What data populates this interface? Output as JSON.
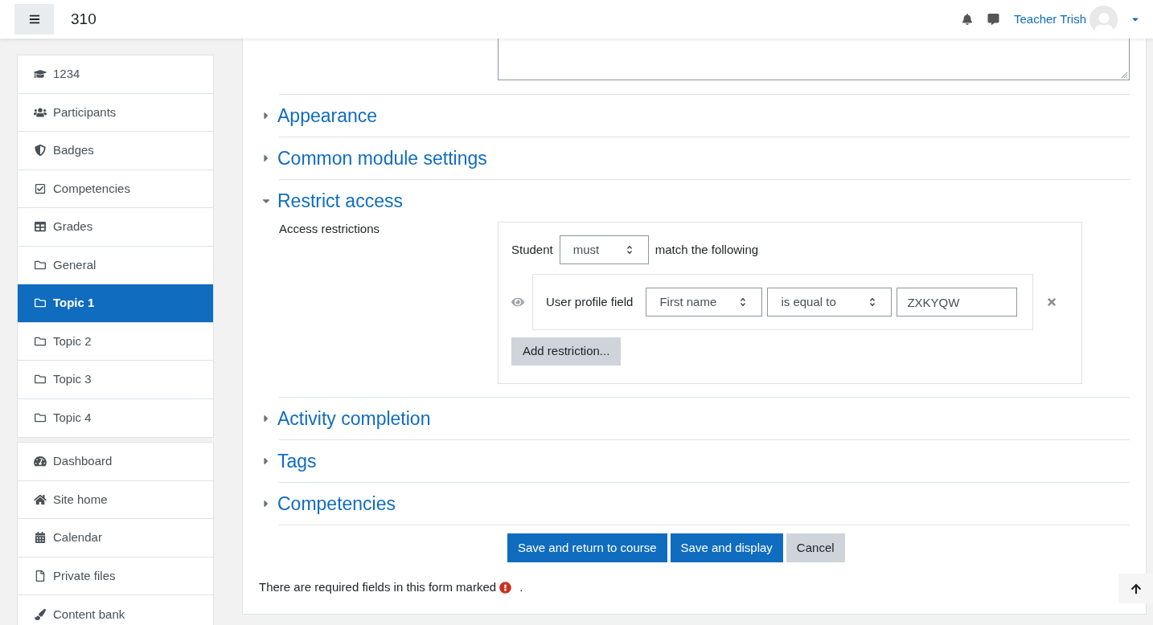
{
  "header": {
    "course": "310",
    "user": "Teacher Trish"
  },
  "nav_groups": [
    [
      {
        "label": "1234",
        "selected": false
      },
      {
        "label": "Participants",
        "selected": false
      },
      {
        "label": "Badges",
        "selected": false
      },
      {
        "label": "Competencies",
        "selected": false
      },
      {
        "label": "Grades",
        "selected": false
      },
      {
        "label": "General",
        "selected": false
      },
      {
        "label": "Topic 1",
        "selected": true
      },
      {
        "label": "Topic 2",
        "selected": false
      },
      {
        "label": "Topic 3",
        "selected": false
      },
      {
        "label": "Topic 4",
        "selected": false
      }
    ],
    [
      {
        "label": "Dashboard",
        "selected": false
      },
      {
        "label": "Site home",
        "selected": false
      },
      {
        "label": "Calendar",
        "selected": false
      },
      {
        "label": "Private files",
        "selected": false
      },
      {
        "label": "Content bank",
        "selected": false
      }
    ]
  ],
  "sections": [
    {
      "title": "Appearance",
      "expanded": false
    },
    {
      "title": "Common module settings",
      "expanded": false
    },
    {
      "title": "Restrict access",
      "expanded": true
    },
    {
      "title": "Activity completion",
      "expanded": false
    },
    {
      "title": "Tags",
      "expanded": false
    },
    {
      "title": "Competencies",
      "expanded": false
    }
  ],
  "restrict": {
    "label": "Access restrictions",
    "subject": "Student",
    "mode": "must",
    "suffix": "match the following",
    "condition": {
      "type": "User profile field",
      "field": "First name",
      "operator": "is equal to",
      "value": "ZXKYQW"
    },
    "add_button": "Add restriction..."
  },
  "buttons": [
    {
      "label": "Save and return to course",
      "kind": "primary"
    },
    {
      "label": "Save and display",
      "kind": "primary"
    },
    {
      "label": "Cancel",
      "kind": "secondary"
    }
  ],
  "required_note": {
    "before": "There are required fields in this form marked",
    "after": "."
  }
}
